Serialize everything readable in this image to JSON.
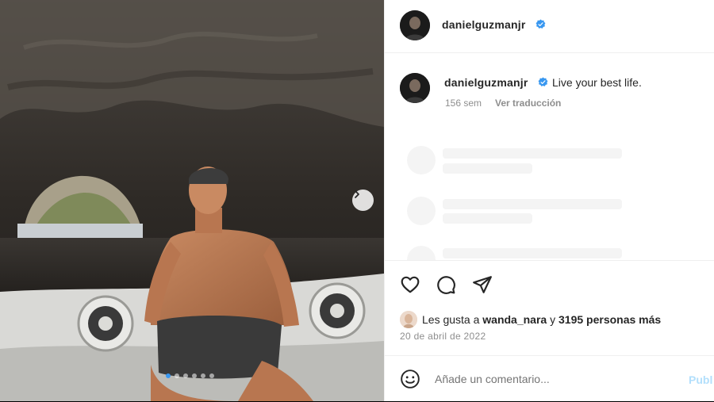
{
  "post": {
    "carousel_slides": 6,
    "active_slide": 1
  },
  "header": {
    "username": "danielguzmanjr",
    "verified": true
  },
  "caption": {
    "username": "danielguzmanjr",
    "text": "Live your best life.",
    "age": "156 sem",
    "translate_label": "Ver traducción"
  },
  "actions": {
    "like_icon": "heart-icon",
    "comment_icon": "comment-icon",
    "share_icon": "share-icon"
  },
  "likes": {
    "prefix": "Les gusta a",
    "user": "wanda_nara",
    "connector": "y",
    "others": "3195 personas más"
  },
  "date": "20 de abril de 2022",
  "comment": {
    "placeholder": "Añade un comentario...",
    "publish_label": "Publ"
  },
  "colors": {
    "verified_blue": "#3897f0",
    "publish_disabled": "#b2dffc"
  }
}
